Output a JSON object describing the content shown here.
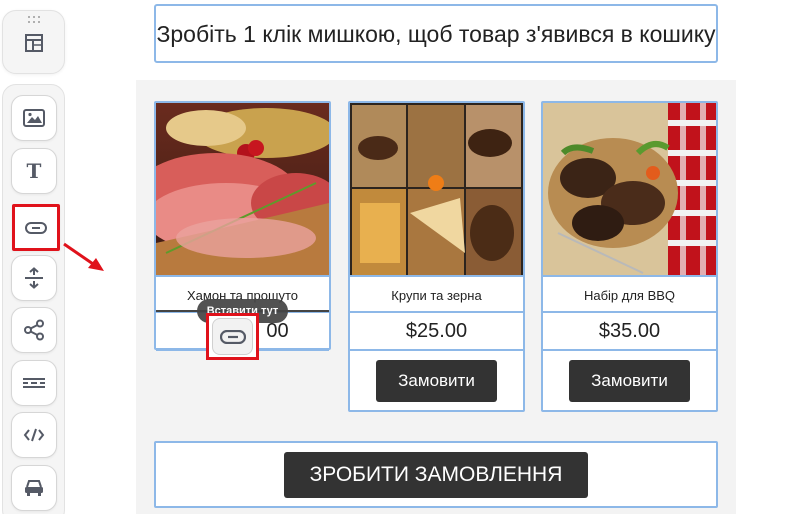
{
  "sidebar": {
    "drag_tab_icon": "layout-icon",
    "tools": [
      {
        "name": "image-block",
        "icon": "image-icon",
        "glyph": ""
      },
      {
        "name": "text-block",
        "icon": "text-icon",
        "glyph": "T"
      },
      {
        "name": "button-block",
        "icon": "button-icon",
        "glyph": ""
      },
      {
        "name": "spacer-block",
        "icon": "spacer-icon",
        "glyph": ""
      },
      {
        "name": "social-block",
        "icon": "share-icon",
        "glyph": ""
      },
      {
        "name": "divider-block",
        "icon": "divider-icon",
        "glyph": ""
      },
      {
        "name": "html-block",
        "icon": "code-icon",
        "glyph": ""
      },
      {
        "name": "product-block",
        "icon": "car-icon",
        "glyph": ""
      }
    ]
  },
  "heading": {
    "text": "Зробіть 1 клік мишкою, щоб товар з'явився в кошику"
  },
  "products": [
    {
      "name": "Хамон та прошуто",
      "price": "",
      "order_label": ""
    },
    {
      "name": "Крупи та зерна",
      "price": "$25.00",
      "order_label": "Замовити"
    },
    {
      "name": "Набір для BBQ",
      "price": "$35.00",
      "order_label": "Замовити"
    }
  ],
  "drop_hint": {
    "tooltip": "Вставити тут",
    "partial_price": "00"
  },
  "submit": {
    "label": "ЗРОБИТИ ЗАМОВЛЕННЯ"
  },
  "colors": {
    "accent_border": "#8db8e8",
    "highlight": "#e0121b",
    "button_bg": "#333333"
  }
}
